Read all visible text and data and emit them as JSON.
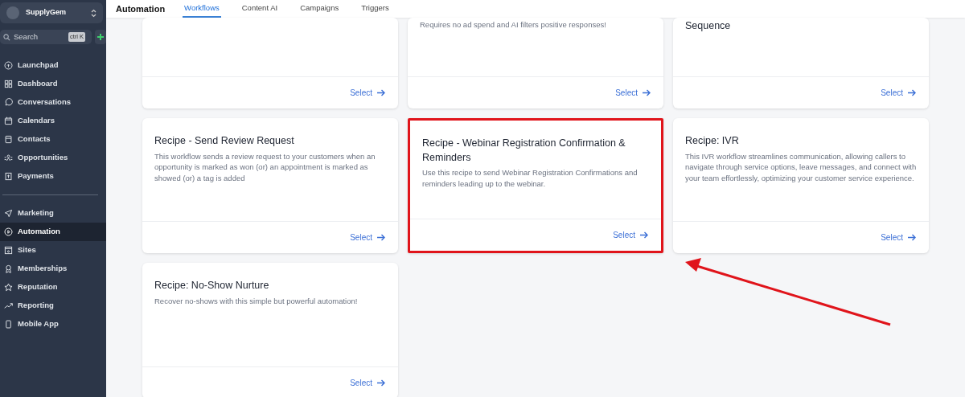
{
  "sidebar": {
    "account": "SupplyGem",
    "search": {
      "placeholder": "Search",
      "shortcut": "ctrl K"
    },
    "items": [
      {
        "label": "Launchpad",
        "selected": false
      },
      {
        "label": "Dashboard",
        "selected": false
      },
      {
        "label": "Conversations",
        "selected": false
      },
      {
        "label": "Calendars",
        "selected": false
      },
      {
        "label": "Contacts",
        "selected": false
      },
      {
        "label": "Opportunities",
        "selected": false
      },
      {
        "label": "Payments",
        "selected": false
      }
    ],
    "items_2": [
      {
        "label": "Marketing",
        "selected": false
      },
      {
        "label": "Automation",
        "selected": true
      },
      {
        "label": "Sites",
        "selected": false
      },
      {
        "label": "Memberships",
        "selected": false
      },
      {
        "label": "Reputation",
        "selected": false
      },
      {
        "label": "Reporting",
        "selected": false
      },
      {
        "label": "Mobile App",
        "selected": false
      }
    ]
  },
  "header": {
    "title": "Automation",
    "tabs": [
      {
        "label": "Workflows",
        "selected": true
      },
      {
        "label": "Content AI",
        "selected": false
      },
      {
        "label": "Campaigns",
        "selected": false
      },
      {
        "label": "Triggers",
        "selected": false
      }
    ]
  },
  "cards": [
    {
      "highlighted": false,
      "action": "Select"
    },
    {
      "description": "Requires no ad spend and AI filters positive responses!",
      "highlighted": false,
      "action": "Select"
    },
    {
      "title": "Sequence",
      "highlighted": false,
      "action": "Select"
    },
    {
      "title": "Recipe - Send Review Request",
      "description": "This workflow sends a review request to your customers when an opportunity is marked as won (or) an appointment is marked as showed (or) a tag is added",
      "highlighted": false,
      "action": "Select"
    },
    {
      "title": "Recipe - Webinar Registration Confirmation & Reminders",
      "description": "Use this recipe to send Webinar Registration Confirmations and reminders leading up to the webinar.",
      "highlighted": true,
      "action": "Select"
    },
    {
      "title": "Recipe: IVR",
      "description": "This IVR workflow streamlines communication, allowing callers to navigate through service options, leave messages, and connect with your team effortlessly, optimizing your customer service experience.",
      "highlighted": false,
      "action": "Select"
    },
    {
      "title": "Recipe: No-Show Nurture",
      "description": "Recover no-shows with this simple but powerful automation!",
      "highlighted": false,
      "action": "Select"
    }
  ]
}
